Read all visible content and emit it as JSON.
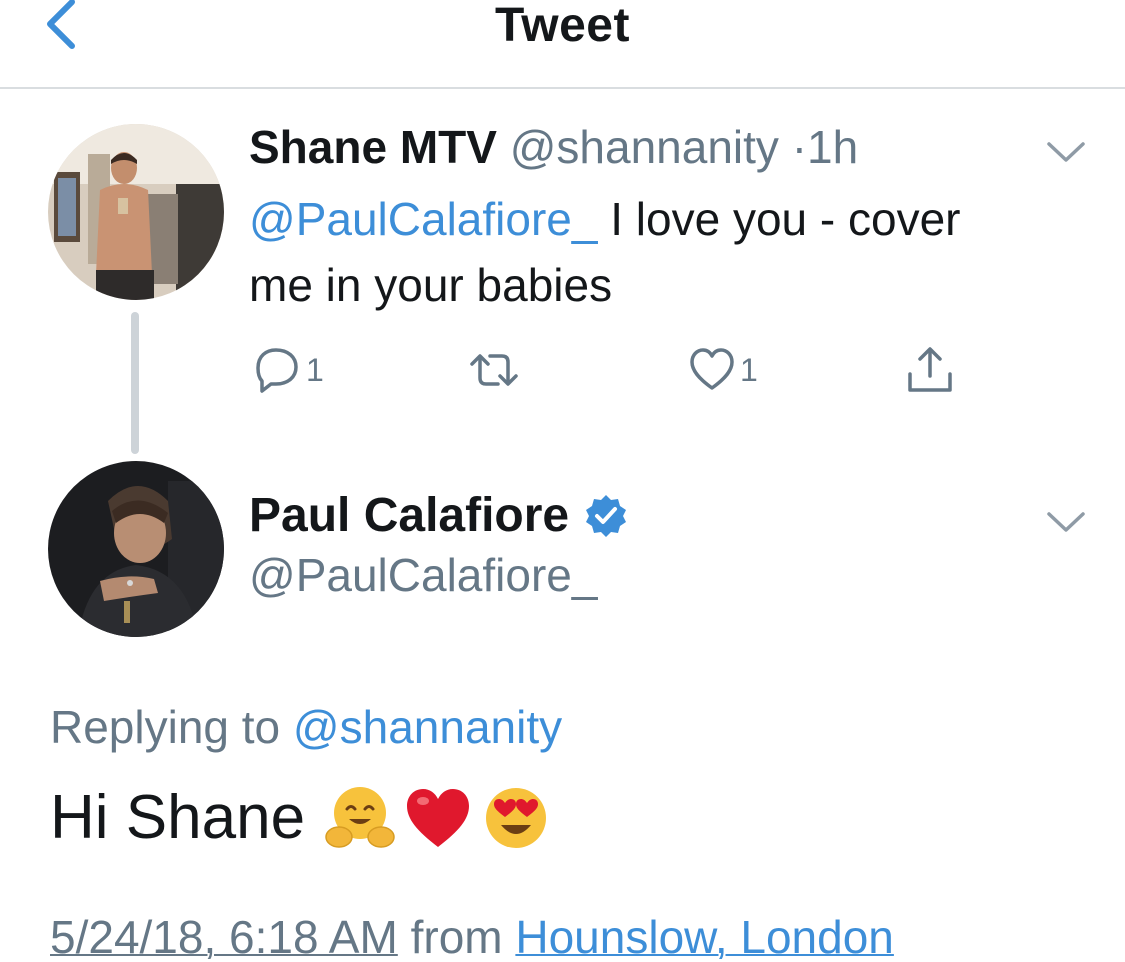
{
  "nav": {
    "title": "Tweet",
    "back_icon": "chevron-left-icon"
  },
  "colors": {
    "link": "#3d8ed8",
    "muted": "#657786",
    "text": "#14171a",
    "verified": "#3d8ed8"
  },
  "parent_tweet": {
    "name": "Shane MTV",
    "handle": "@shannanity",
    "separator": "·",
    "time": "1h",
    "mention": "@PaulCalafiore_",
    "text": " I love you - cover me in your babies",
    "actions": {
      "reply_count": "1",
      "retweet_count": "",
      "like_count": "1"
    }
  },
  "main_tweet": {
    "name": "Paul Calafiore",
    "verified": true,
    "handle": "@PaulCalafiore_",
    "replying_prefix": "Replying to ",
    "replying_handle": "@shannanity",
    "text": "Hi Shane",
    "emojis": [
      "hugging-face",
      "red-heart",
      "heart-eyes"
    ],
    "timestamp": "5/24/18, 6:18 AM",
    "from_label": " from ",
    "location": "Hounslow, London"
  }
}
